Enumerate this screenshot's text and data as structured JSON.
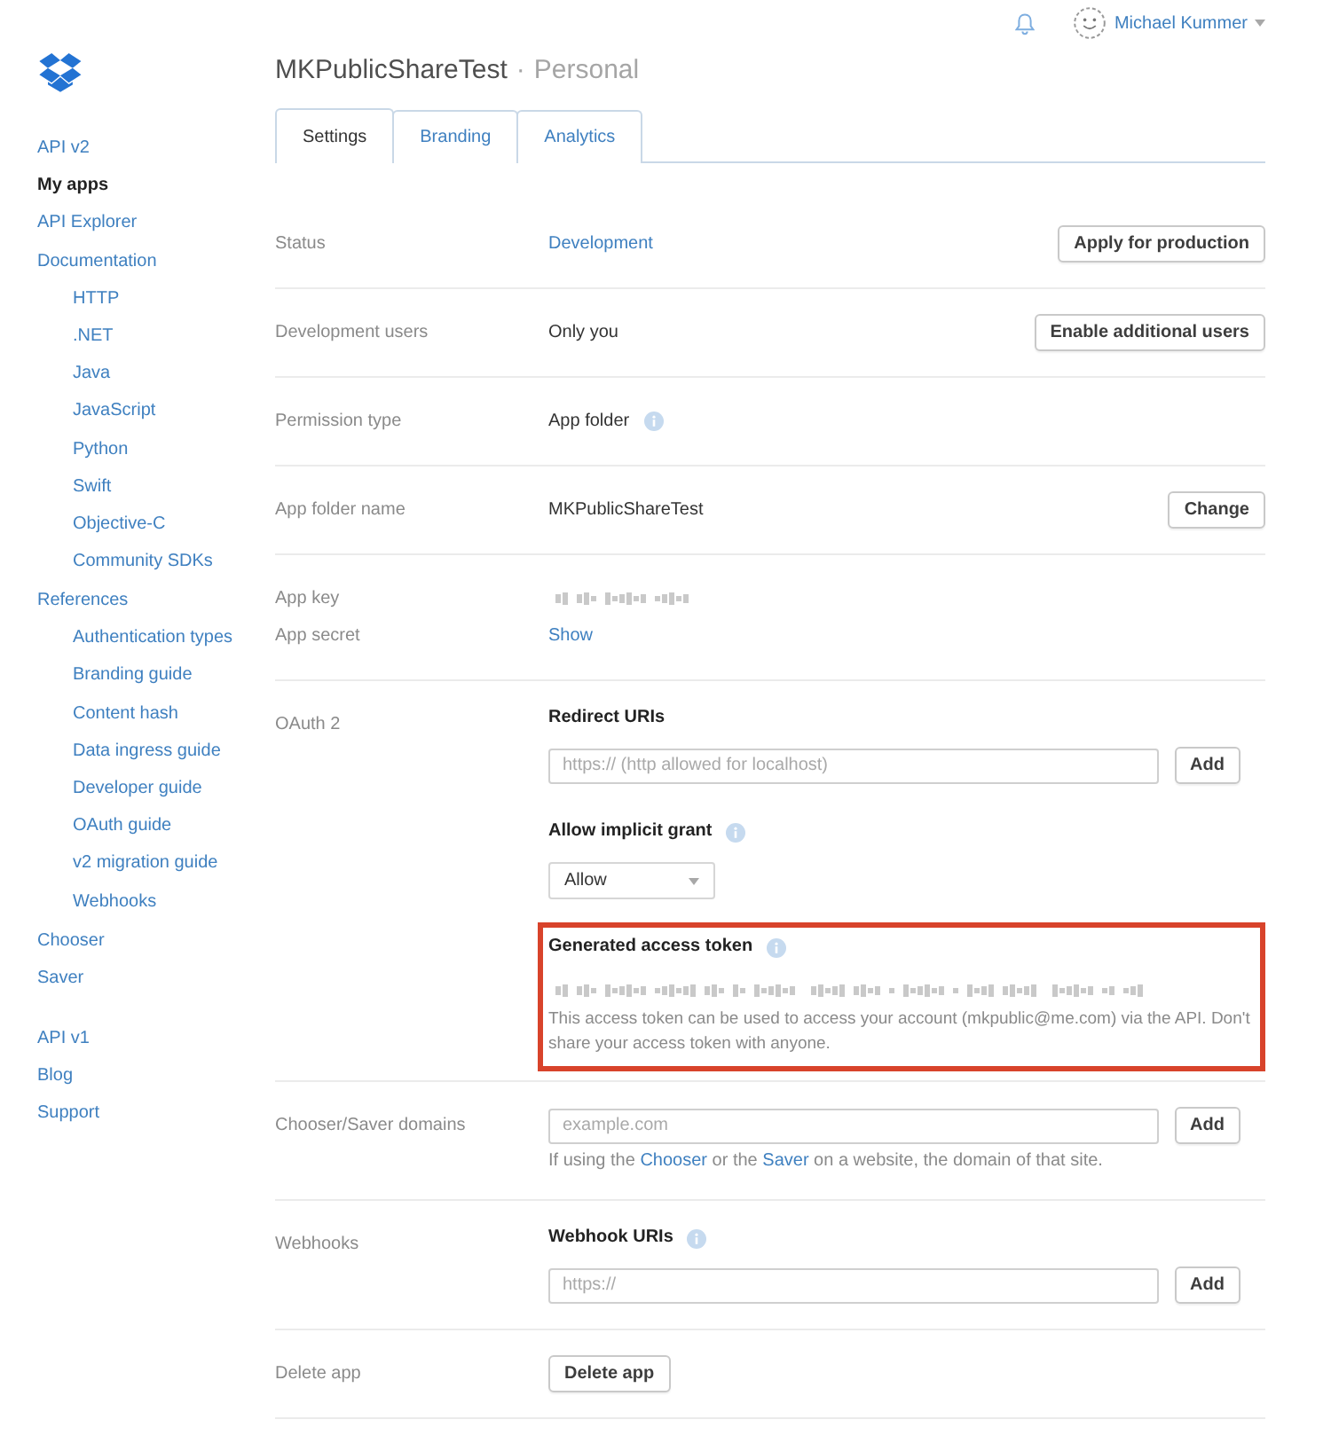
{
  "header": {
    "user_name": "Michael Kummer"
  },
  "sidebar": {
    "groups": [
      {
        "items": [
          {
            "label": "API v2",
            "selected": false
          },
          {
            "label": "My apps",
            "selected": true
          },
          {
            "label": "API Explorer",
            "selected": false
          },
          {
            "label": "Documentation",
            "selected": false,
            "children": [
              {
                "label": "HTTP",
                "selected": false
              },
              {
                "label": ".NET",
                "selected": false
              },
              {
                "label": "Java",
                "selected": false
              },
              {
                "label": "JavaScript",
                "selected": false
              },
              {
                "label": "Python",
                "selected": false
              },
              {
                "label": "Swift",
                "selected": false
              },
              {
                "label": "Objective-C",
                "selected": false
              },
              {
                "label": "Community SDKs",
                "selected": false
              }
            ]
          }
        ]
      },
      {
        "items": [
          {
            "label": "References",
            "selected": false,
            "children": [
              {
                "label": "Authentication types",
                "selected": false
              },
              {
                "label": "Branding guide",
                "selected": false
              },
              {
                "label": "Content hash",
                "selected": false
              },
              {
                "label": "Data ingress guide",
                "selected": false
              },
              {
                "label": "Developer guide",
                "selected": false
              },
              {
                "label": "OAuth guide",
                "selected": false
              },
              {
                "label": "v2 migration guide",
                "selected": false
              },
              {
                "label": "Webhooks",
                "selected": false
              }
            ]
          }
        ]
      },
      {
        "items": [
          {
            "label": "Chooser",
            "selected": false
          },
          {
            "label": "Saver",
            "selected": false
          }
        ]
      },
      {
        "items": [
          {
            "label": "API v1",
            "selected": false
          },
          {
            "label": "Blog",
            "selected": false
          },
          {
            "label": "Support",
            "selected": false
          }
        ]
      }
    ]
  },
  "app": {
    "name": "MKPublicShareTest",
    "separator": "·",
    "plan": "Personal"
  },
  "tabs": [
    {
      "label": "Settings",
      "selected": true
    },
    {
      "label": "Branding",
      "selected": false
    },
    {
      "label": "Analytics",
      "selected": false
    }
  ],
  "settings": [
    {
      "lines": [
        {
          "label": "Status",
          "blocks": [
            {
              "kind": "link",
              "text": "Development"
            }
          ]
        }
      ],
      "button": "Apply for production"
    },
    {
      "lines": [
        {
          "label": "Development users",
          "blocks": [
            {
              "kind": "text",
              "text": "Only you"
            }
          ]
        }
      ],
      "button": "Enable additional users"
    },
    {
      "lines": [
        {
          "label": "Permission type",
          "blocks": [
            {
              "kind": "text",
              "text": "App folder",
              "info": true
            }
          ]
        }
      ]
    },
    {
      "lines": [
        {
          "label": "App folder name",
          "blocks": [
            {
              "kind": "text",
              "text": "MKPublicShareTest"
            }
          ]
        }
      ],
      "button": "Change"
    },
    {
      "lines": [
        {
          "label": "App key",
          "blocks": [
            {
              "kind": "redacted"
            }
          ]
        },
        {
          "label": "App secret",
          "blocks": [
            {
              "kind": "link",
              "text": "Show"
            }
          ]
        }
      ]
    },
    {
      "lines": [
        {
          "label": "OAuth 2",
          "blocks": [
            {
              "kind": "heading",
              "text": "Redirect URIs"
            },
            {
              "kind": "field",
              "placeholder": "https:// (http allowed for localhost)",
              "button": "Add"
            },
            {
              "kind": "heading",
              "text": "Allow implicit grant",
              "info": true
            },
            {
              "kind": "select",
              "value": "Allow"
            },
            {
              "kind": "group",
              "highlighted": true,
              "blocks": [
                {
                  "kind": "heading",
                  "text": "Generated access token",
                  "info": true
                },
                {
                  "kind": "redacted"
                },
                {
                  "kind": "note",
                  "parts": [
                    {
                      "kind": "text",
                      "text": "This access token can be used to access your account (mkpublic@me.com) via the API. Don't share your access token with anyone."
                    }
                  ]
                }
              ]
            }
          ]
        }
      ]
    },
    {
      "lines": [
        {
          "label": "Chooser/Saver domains",
          "blocks": [
            {
              "kind": "field",
              "placeholder": "example.com",
              "button": "Add"
            },
            {
              "kind": "note",
              "parts": [
                {
                  "kind": "text",
                  "text": "If using the "
                },
                {
                  "kind": "link",
                  "text": "Chooser"
                },
                {
                  "kind": "text",
                  "text": " or the "
                },
                {
                  "kind": "link",
                  "text": "Saver"
                },
                {
                  "kind": "text",
                  "text": " on a website, the domain of that site."
                }
              ]
            }
          ]
        }
      ]
    },
    {
      "lines": [
        {
          "label": "Webhooks",
          "blocks": [
            {
              "kind": "heading",
              "text": "Webhook URIs",
              "info": true
            },
            {
              "kind": "field",
              "placeholder": "https://",
              "button": "Add"
            }
          ]
        }
      ]
    },
    {
      "lines": [
        {
          "label": "Delete app",
          "blocks": [
            {
              "kind": "button",
              "text": "Delete app"
            }
          ]
        }
      ]
    }
  ]
}
